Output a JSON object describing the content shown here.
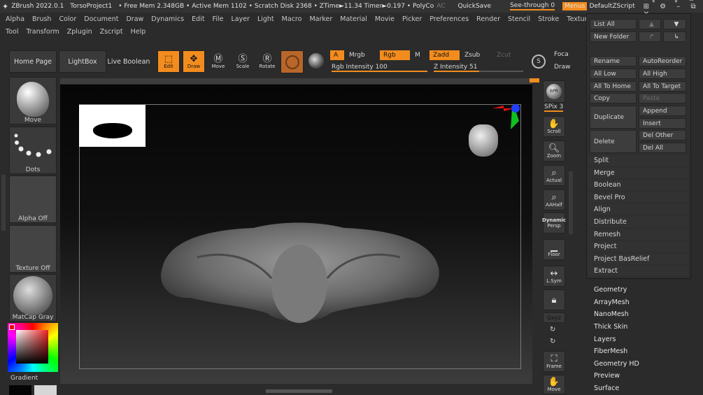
{
  "titlebar": {
    "app": "ZBrush 2022.0.1",
    "project": "TorsoProject1",
    "stats": "• Free Mem 2.348GB • Active Mem 1102 • Scratch Disk 2368 • ZTime►11.34 Timer►0.197 • PolyCo",
    "ac": "AC",
    "quicksave": "QuickSave",
    "seethrough": "See-through  0",
    "menus": "Menus",
    "script": "DefaultZScript"
  },
  "menu_row1": [
    "Alpha",
    "Brush",
    "Color",
    "Document",
    "Draw",
    "Dynamics",
    "Edit",
    "File",
    "Layer",
    "Light",
    "Macro",
    "Marker",
    "Material",
    "Movie",
    "Picker",
    "Preferences",
    "Render",
    "Stencil",
    "Stroke",
    "Texture"
  ],
  "menu_row2": [
    "Tool",
    "Transform",
    "Zplugin",
    "Zscript",
    "Help"
  ],
  "shelf": {
    "home_page": "Home Page",
    "lightbox": "LightBox",
    "live_boolean": "Live Boolean",
    "edit": "Edit",
    "draw": "Draw",
    "move": "Move",
    "scale": "Scale",
    "rotate": "Rotate",
    "a": "A",
    "mrgb": "Mrgb",
    "rgb": "Rgb",
    "m": "M",
    "zadd": "Zadd",
    "zsub": "Zsub",
    "zcut": "Zcut",
    "rgb_intensity_label": "Rgb Intensity 100",
    "rgb_intensity": 100,
    "z_intensity_label": "Z Intensity 51",
    "z_intensity": 51,
    "focal": "Foca",
    "draw_size": "Draw"
  },
  "left_tray": {
    "brush": "Move",
    "stroke": "Dots",
    "alpha": "Alpha Off",
    "texture": "Texture Off",
    "material": "MatCap Gray",
    "gradient": "Gradient"
  },
  "right_shelf": {
    "bpr": "BPR",
    "spix": "SPix 3",
    "scroll": "Scroll",
    "zoom": "Zoom",
    "actual": "Actual",
    "aahalf": "AAHalf",
    "dynamic": "Dynamic",
    "persp": "Persp",
    "floor": "Floor",
    "lsym": "L.Sym",
    "xyz": "Qxyz",
    "frame": "Frame",
    "move": "Move"
  },
  "subtool_panel": {
    "list_all": "List All",
    "new_folder": "New Folder",
    "rename": "Rename",
    "auto_reorder": "AutoReorder",
    "all_low": "All Low",
    "all_high": "All High",
    "all_to_home": "All To Home",
    "all_to_target": "All To Target",
    "copy": "Copy",
    "paste": "Paste",
    "duplicate": "Duplicate",
    "append": "Append",
    "insert": "Insert",
    "delete": "Delete",
    "del_other": "Del Other",
    "del_all": "Del All",
    "actions": [
      "Split",
      "Merge",
      "Boolean",
      "Bevel Pro",
      "Align",
      "Distribute",
      "Remesh",
      "Project",
      "Project BasRelief",
      "Extract"
    ]
  },
  "tool_subpalettes": [
    "Geometry",
    "ArrayMesh",
    "NanoMesh",
    "Thick Skin",
    "Layers",
    "FiberMesh",
    "Geometry HD",
    "Preview",
    "Surface"
  ],
  "colors": {
    "accent": "#f28c1e",
    "panel": "#2f2f2f",
    "canvas_top": "#060606",
    "canvas_bottom": "#3c3c3c"
  }
}
